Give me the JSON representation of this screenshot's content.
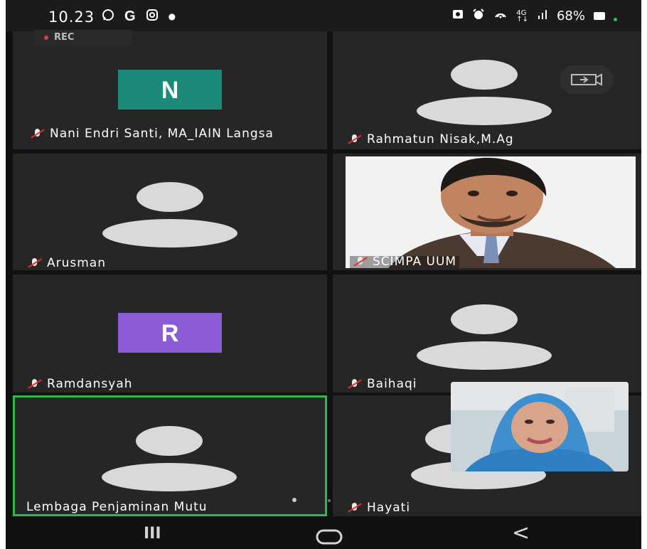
{
  "status_bar": {
    "time": "10.23",
    "left_icons": [
      "whatsapp-icon",
      "google-icon",
      "instagram-icon",
      "dot-icon"
    ],
    "right_icons": [
      "gallery-icon",
      "alarm-icon",
      "hotspot-icon",
      "4g-icon",
      "signal-icon"
    ],
    "battery": "68%"
  },
  "recording": {
    "label": "REC"
  },
  "participants": [
    {
      "name": "Nani Endri Santi, MA_IAIN Langsa",
      "avatar_letter": "N",
      "avatar_color": "#1b8a78",
      "muted": true
    },
    {
      "name": "Rahmatun Nisak,M.Ag",
      "avatar_letter": "",
      "muted": true
    },
    {
      "name": "Arusman",
      "avatar_letter": "",
      "muted": true
    },
    {
      "name": "SCIMPA UUM",
      "avatar_letter": "",
      "muted": true,
      "video": true
    },
    {
      "name": "Ramdansyah",
      "avatar_letter": "R",
      "avatar_color": "#8c5cd6",
      "muted": true
    },
    {
      "name": "Baihaqi",
      "avatar_letter": "",
      "muted": true
    },
    {
      "name": "Lembaga Penjaminan Mutu",
      "avatar_letter": "",
      "muted": false,
      "active_speaker": true
    },
    {
      "name": "Hayati",
      "avatar_letter": "",
      "muted": true
    }
  ],
  "active_speaker_border": "#2db84b",
  "camera_switch_icon": "switch-camera-icon",
  "nav_bar": {
    "recent": "III",
    "home": "home-icon",
    "back": "<"
  }
}
